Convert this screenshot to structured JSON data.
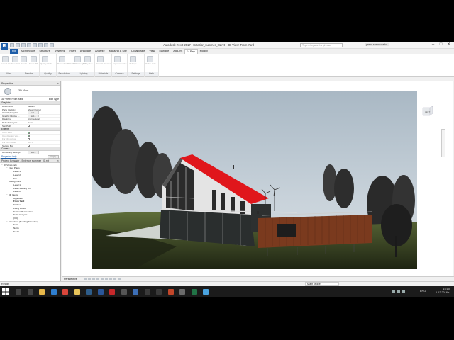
{
  "window": {
    "title": "Autodesk Revit 2017 - Exterior_summer_01.rvt - 3D View: From Yard",
    "search_placeholder": "Type a keyword or phrase",
    "user": "yaroo.samokovsko",
    "controls": [
      "–",
      "□",
      "✕"
    ]
  },
  "logo": "R",
  "menu": {
    "tabs": [
      "File",
      "Architecture",
      "Structure",
      "Systems",
      "Insert",
      "Annotate",
      "Analyze",
      "Massing & Site",
      "Collaborate",
      "View",
      "Manage",
      "Add-Ins",
      "V-Ray",
      "Modify"
    ],
    "active_tab": "V-Ray"
  },
  "ribbon": {
    "groups": [
      {
        "label": "View",
        "buttons": [
          "Current View",
          "From Start"
        ]
      },
      {
        "label": "Render",
        "buttons": [
          "Render",
          "Show VFB"
        ]
      },
      {
        "label": "Quality",
        "buttons": [
          "Quality Draft"
        ]
      },
      {
        "label": "Resolution",
        "buttons": [
          "Resolution 800x600"
        ]
      },
      {
        "label": "Lighting",
        "buttons": [
          "Artificial Lights",
          "V-Ray Sun"
        ]
      },
      {
        "label": "Materials",
        "buttons": [
          "Material Browser"
        ]
      },
      {
        "label": "Camera",
        "buttons": [
          "Exposure Value"
        ]
      },
      {
        "label": "Settings",
        "buttons": [
          "Settings"
        ]
      },
      {
        "label": "Help",
        "buttons": [
          "Online Help"
        ]
      }
    ]
  },
  "properties": {
    "title": "Properties",
    "type_label": "3D View",
    "instance": "3D View: From Yard",
    "edit_type": "Edit Type",
    "categories": [
      {
        "name": "Graphics",
        "rows": [
          {
            "name": "Detail Level",
            "value": "Medium"
          },
          {
            "name": "Parts Visibility",
            "value": "Show Original"
          },
          {
            "name": "Visibility/Graphic...",
            "value": "Edit..."
          },
          {
            "name": "Graphic Display ...",
            "value": "Edit..."
          },
          {
            "name": "Discipline",
            "value": "Architectural"
          },
          {
            "name": "Default Analysis ...",
            "value": "None"
          },
          {
            "name": "Sun Path",
            "value": ""
          }
        ]
      },
      {
        "name": "Extents",
        "rows": [
          {
            "name": "Crop View",
            "value": ""
          },
          {
            "name": "Crop Region Visi...",
            "value": ""
          },
          {
            "name": "Far Clip Active",
            "value": ""
          },
          {
            "name": "Far Clip Offset",
            "value": "304.8"
          },
          {
            "name": "Section Box",
            "value": ""
          }
        ]
      },
      {
        "name": "Camera",
        "rows": [
          {
            "name": "Rendering Settings",
            "value": "Edit..."
          }
        ]
      }
    ],
    "help_link": "Properties help",
    "apply": "Apply"
  },
  "project_browser": {
    "title": "Project Browser - Exterior_summer_01.rvt",
    "nodes": [
      {
        "level": 0,
        "toggle": "−",
        "label": "[0] Views (all)"
      },
      {
        "level": 1,
        "toggle": "−",
        "label": "Floor Plans"
      },
      {
        "level": 2,
        "toggle": "",
        "label": "Level 1"
      },
      {
        "level": 2,
        "toggle": "",
        "label": "Level 2"
      },
      {
        "level": 2,
        "toggle": "",
        "label": "Site"
      },
      {
        "level": 1,
        "toggle": "−",
        "label": "Ceiling Plans"
      },
      {
        "level": 2,
        "toggle": "",
        "label": "Level 1"
      },
      {
        "level": 2,
        "toggle": "",
        "label": "Level 1 Living Rm"
      },
      {
        "level": 2,
        "toggle": "",
        "label": "Level 2"
      },
      {
        "level": 1,
        "toggle": "−",
        "label": "3D Views"
      },
      {
        "level": 2,
        "toggle": "",
        "label": "Approach"
      },
      {
        "level": 2,
        "toggle": "",
        "label": "From Yard",
        "selected": true
      },
      {
        "level": 2,
        "toggle": "",
        "label": "Kitchen"
      },
      {
        "level": 2,
        "toggle": "",
        "label": "Living Room"
      },
      {
        "level": 2,
        "toggle": "",
        "label": "Section Perspective"
      },
      {
        "level": 2,
        "toggle": "",
        "label": "Solar Analysis"
      },
      {
        "level": 2,
        "toggle": "",
        "label": "{3D}"
      },
      {
        "level": 1,
        "toggle": "−",
        "label": "Elevations (Building Elevation)"
      },
      {
        "level": 2,
        "toggle": "",
        "label": "East"
      },
      {
        "level": 2,
        "toggle": "",
        "label": "North"
      },
      {
        "level": 2,
        "toggle": "",
        "label": "South"
      }
    ]
  },
  "viewport": {
    "view_label": "Perspective",
    "viewcube_label": "LEFT"
  },
  "status": {
    "ready": "Ready",
    "model": "Main Model"
  },
  "taskbar": {
    "time": "16:10",
    "date": "1.12.2016 г.",
    "language": "ENG",
    "apps": [
      {
        "icon": "search-icon",
        "color": "#444444"
      },
      {
        "icon": "task-view-icon",
        "color": "#444444"
      },
      {
        "icon": "file-explorer-icon",
        "color": "#e8b84a"
      },
      {
        "icon": "edge-icon",
        "color": "#2f7fd0"
      },
      {
        "icon": "chrome-icon",
        "color": "#d9463b"
      },
      {
        "icon": "folder-icon",
        "color": "#e8c45a"
      },
      {
        "icon": "photoshop-icon",
        "color": "#2e5d8a"
      },
      {
        "icon": "word-icon",
        "color": "#2a5699"
      },
      {
        "icon": "acrobat-icon",
        "color": "#c6282b"
      },
      {
        "icon": "terminal-icon",
        "color": "#555555"
      },
      {
        "icon": "revit-icon",
        "color": "#3d6fb6"
      },
      {
        "icon": "app-icon",
        "color": "#3a3a3a"
      },
      {
        "icon": "app-icon",
        "color": "#3a3a3a"
      },
      {
        "icon": "powerpoint-icon",
        "color": "#c2472a"
      },
      {
        "icon": "app-icon",
        "color": "#6b6b6b"
      },
      {
        "icon": "excel-icon",
        "color": "#217346"
      },
      {
        "icon": "snowflake-icon",
        "color": "#4aa3df"
      }
    ]
  },
  "colors": {
    "accent": "#1d5da8",
    "roof": "#e0161b",
    "sky": "#b8c6d0"
  }
}
